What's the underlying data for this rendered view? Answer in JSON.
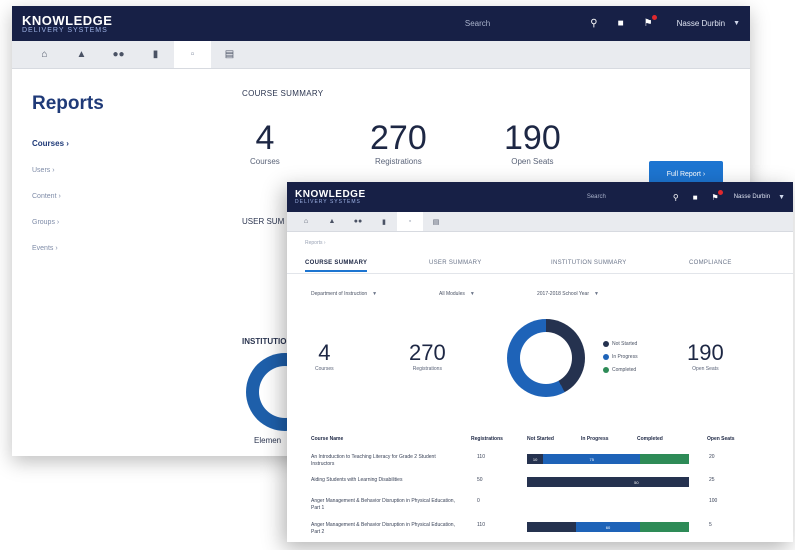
{
  "colors": {
    "navbar": "#172046",
    "accent": "#1d75d1",
    "not_started": "#25324f",
    "in_progress": "#1e63b8",
    "completed": "#2e8b57"
  },
  "back": {
    "logo_line1": "KNOWLEDGE",
    "logo_line2": "DELIVERY SYSTEMS",
    "search_label": "Search",
    "user_name": "Nasse Durbin",
    "page_title": "Reports",
    "sidebar": [
      "Courses ›",
      "Users ›",
      "Content ›",
      "Groups ›",
      "Events ›"
    ],
    "course_summary_title": "COURSE SUMMARY",
    "stats": [
      {
        "num": "4",
        "label": "Courses"
      },
      {
        "num": "270",
        "label": "Registrations"
      },
      {
        "num": "190",
        "label": "Open Seats"
      }
    ],
    "full_report_button": "Full Report ›",
    "user_summary_title": "USER SUM",
    "institution_title": "INSTITUTIO",
    "elem_label": "Elemen"
  },
  "front": {
    "logo_line1": "KNOWLEDGE",
    "logo_line2": "DELIVERY SYSTEMS",
    "search_label": "Search",
    "user_name": "Nasse Durbin",
    "crumb": "Reports ›",
    "tabs": [
      "COURSE SUMMARY",
      "USER SUMMARY",
      "INSTITUTION SUMMARY",
      "COMPLIANCE"
    ],
    "filters": [
      "Department of Instruction",
      "All Modules",
      "2017-2018 School Year"
    ],
    "stats": [
      {
        "num": "4",
        "label": "Courses"
      },
      {
        "num": "270",
        "label": "Registrations"
      },
      {
        "num": "190",
        "label": "Open Seats"
      }
    ],
    "legend": [
      "Not Started",
      "In Progress",
      "Completed"
    ],
    "table_headers": {
      "course": "Course Name",
      "registrations": "Registrations",
      "not_started": "Not Started",
      "in_progress": "In Progress",
      "completed": "Completed",
      "open_seats": "Open Seats"
    },
    "rows": [
      {
        "name": "An Introduction to Teaching Literacy for Grade 2 Student Instructors",
        "reg": "110",
        "open": "20",
        "segs": [
          {
            "v": "10",
            "f": 0.1,
            "c": "not_started"
          },
          {
            "v": "75",
            "f": 0.6,
            "c": "in_progress"
          },
          {
            "v": "",
            "f": 0.3,
            "c": "completed"
          }
        ]
      },
      {
        "name": "Aiding Students with Learning Disabilities",
        "reg": "50",
        "open": "25",
        "segs": [
          {
            "v": "",
            "f": 0.35,
            "c": "not_started"
          },
          {
            "v": "50",
            "f": 0.65,
            "c": "not_started"
          }
        ]
      },
      {
        "name": "Anger Management & Behavior Disruption in Physical Education, Part 1",
        "reg": "0",
        "open": "100",
        "segs": []
      },
      {
        "name": "Anger Management & Behavior Disruption in Physical Education, Part 2",
        "reg": "110",
        "open": "5",
        "segs": [
          {
            "v": "",
            "f": 0.3,
            "c": "not_started"
          },
          {
            "v": "60",
            "f": 0.4,
            "c": "in_progress"
          },
          {
            "v": "",
            "f": 0.3,
            "c": "completed"
          }
        ]
      }
    ]
  }
}
